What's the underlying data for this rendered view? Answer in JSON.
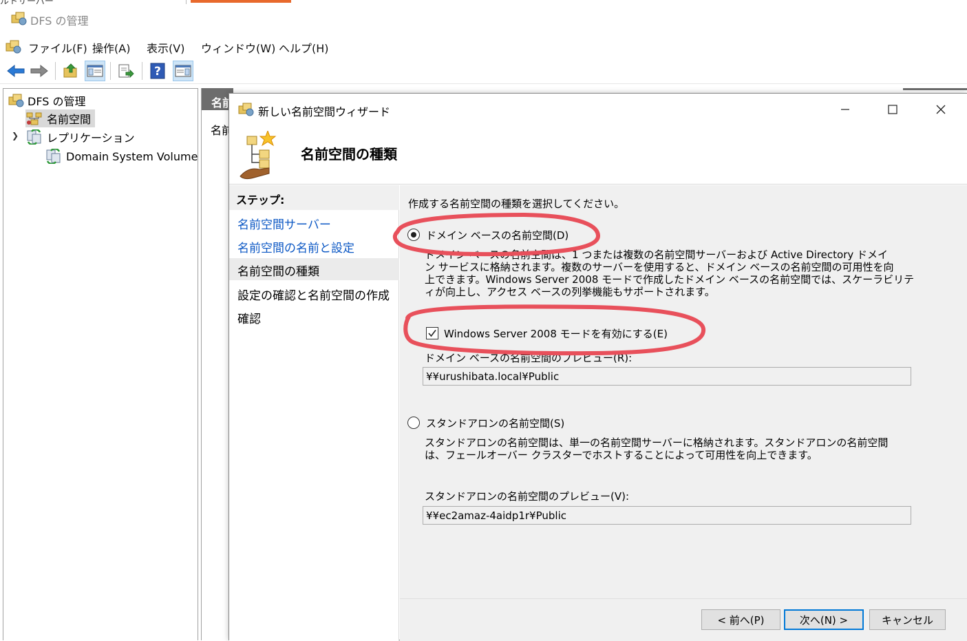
{
  "top_strip": {
    "cut_text": "ルトサーバー"
  },
  "main_window": {
    "title": "DFS の管理",
    "menu": [
      "ファイル(F)",
      "操作(A)",
      "表示(V)",
      "ウィンドウ(W)",
      "ヘルプ(H)"
    ],
    "toolbar_icons": [
      "back-icon",
      "forward-icon",
      "up-folder-icon",
      "console-tree-icon",
      "export-icon",
      "help-icon",
      "action-pane-icon"
    ]
  },
  "tree": {
    "root": "DFS の管理",
    "items": [
      {
        "label": "名前空間",
        "selected": true
      },
      {
        "label": "レプリケーション",
        "expanded": true
      },
      {
        "label": "Domain System Volume"
      }
    ]
  },
  "middle_pane": {
    "header": "名前空間",
    "label": "名前空間"
  },
  "wizard": {
    "title": "新しい名前空間ウィザード",
    "controls": {
      "minimize": "─",
      "maximize": "☐",
      "close": "✕"
    },
    "header": "名前空間の種類",
    "steps_header": "ステップ:",
    "steps": [
      {
        "label": "名前空間サーバー",
        "state": "link"
      },
      {
        "label": "名前空間の名前と設定",
        "state": "link"
      },
      {
        "label": "名前空間の種類",
        "state": "current"
      },
      {
        "label": "設定の確認と名前空間の作成",
        "state": "pending"
      },
      {
        "label": "確認",
        "state": "pending"
      }
    ],
    "instruction": "作成する名前空間の種類を選択してください。",
    "domain_option": {
      "label": "ドメイン ベースの名前空間(D)",
      "selected": true,
      "description": [
        "ドメイン ベースの名前空間は、1 つまたは複数の名前空間サーバーおよび Active Directory ドメイ",
        "ン サービスに格納されます。複数のサーバーを使用すると、ドメイン ベースの名前空間の可用性を向",
        "上できます。Windows Server 2008 モードで作成したドメイン ベースの名前空間では、スケーラビリテ",
        "ィが向上し、アクセス ベースの列挙機能もサポートされます。"
      ],
      "checkbox_label": "Windows Server 2008 モードを有効にする(E)",
      "checkbox_checked": true,
      "preview_label": "ドメイン ベースの名前空間のプレビュー(R):",
      "preview_value": "¥¥urushibata.local¥Public"
    },
    "standalone_option": {
      "label": "スタンドアロンの名前空間(S)",
      "selected": false,
      "description": [
        "スタンドアロンの名前空間は、単一の名前空間サーバーに格納されます。スタンドアロンの名前空間",
        "は、フェールオーバー クラスターでホストすることによって可用性を向上できます。"
      ],
      "preview_label": "スタンドアロンの名前空間のプレビュー(V):",
      "preview_value": "¥¥ec2amaz-4aidp1r¥Public"
    },
    "buttons": {
      "back": "< 前へ(P)",
      "next": "次へ(N) >",
      "cancel": "キャンセル"
    }
  },
  "annotation_color": "#e8505b"
}
